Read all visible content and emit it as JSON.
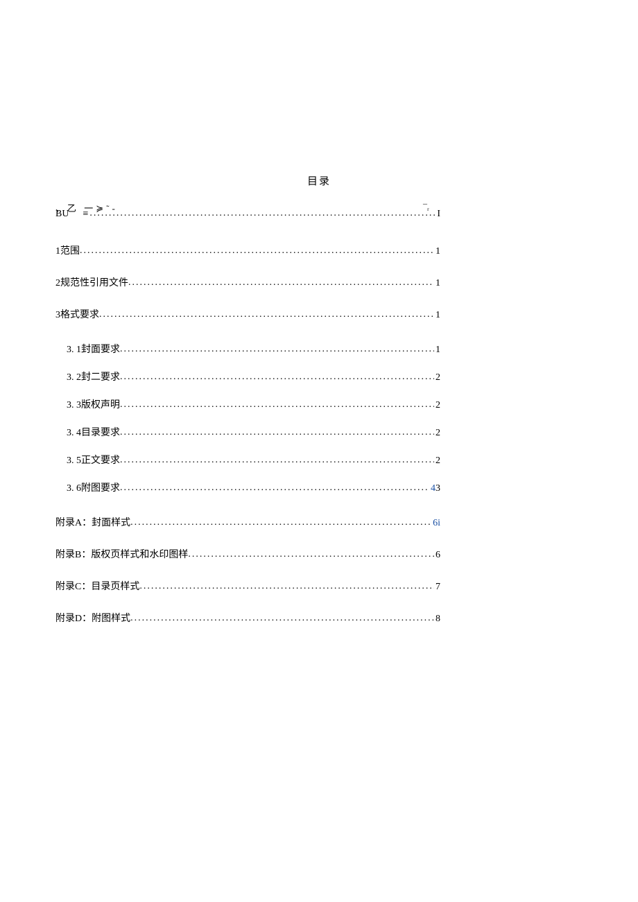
{
  "title": "目录",
  "artifact": {
    "top_left": "、乙  一≽˜-",
    "top_right": "¯ᵣ",
    "bu": "BU",
    "eq": "≡",
    "page": "I"
  },
  "entries": [
    {
      "label": "1范围",
      "page": "1",
      "indent": 0
    },
    {
      "label": "2规范性引用文件",
      "page": "1",
      "indent": 0
    },
    {
      "label": "3格式要求",
      "page": "1",
      "indent": 0
    }
  ],
  "sub_entries": [
    {
      "label": "3.  1封面要求 ",
      "page": "1"
    },
    {
      "label": "3.  2封二要求 ",
      "page": "2"
    },
    {
      "label": "3. 3版权声明 ",
      "page": "2"
    },
    {
      "label": "3. 4目录要求 ",
      "page": "2"
    },
    {
      "label": "3.  5正文要求 ",
      "page": "2"
    },
    {
      "label": "3. 6附图要求 ",
      "page_parts": [
        {
          "text": "4",
          "link": true
        },
        {
          "text": "3",
          "link": false
        }
      ]
    }
  ],
  "appendices": [
    {
      "label": "附录A：封面样式 ",
      "page_parts": [
        {
          "text": "6i",
          "link": true
        }
      ]
    },
    {
      "label": "附录B：版权页样式和水印图样",
      "page": "6"
    },
    {
      "label": "附录C：目录页样式",
      "page": "7"
    },
    {
      "label": "附录D：附图样式",
      "page": "8"
    }
  ]
}
